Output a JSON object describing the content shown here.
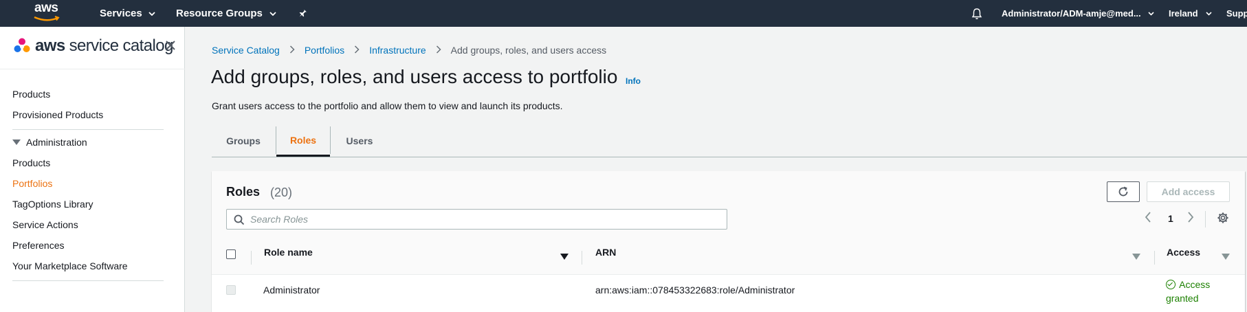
{
  "topnav": {
    "logo": "aws",
    "services_label": "Services",
    "resource_groups_label": "Resource Groups",
    "account_label": "Administrator/ADM-amje@med...",
    "region_label": "Ireland",
    "support_label": "Supp"
  },
  "sidebar": {
    "title_bold": "aws",
    "title_rest": " service catalog",
    "items": [
      {
        "label": "Products"
      },
      {
        "label": "Provisioned Products"
      }
    ],
    "admin_section_label": "Administration",
    "admin_items": [
      {
        "label": "Products"
      },
      {
        "label": "Portfolios"
      },
      {
        "label": "TagOptions Library"
      },
      {
        "label": "Service Actions"
      },
      {
        "label": "Preferences"
      },
      {
        "label": "Your Marketplace Software"
      }
    ]
  },
  "breadcrumb": {
    "items": [
      "Service Catalog",
      "Portfolios",
      "Infrastructure"
    ],
    "current": "Add groups, roles, and users access"
  },
  "page": {
    "title": "Add groups, roles, and users access to portfolio",
    "info_label": "Info",
    "description": "Grant users access to the portfolio and allow them to view and launch its products."
  },
  "tabs": [
    {
      "label": "Groups"
    },
    {
      "label": "Roles"
    },
    {
      "label": "Users"
    }
  ],
  "roles_panel": {
    "title": "Roles",
    "count": "(20)",
    "add_access_label": "Add access",
    "search_placeholder": "Search Roles",
    "current_page": "1",
    "columns": {
      "role_name": "Role name",
      "arn": "ARN",
      "access": "Access"
    },
    "rows": [
      {
        "role_name": "Administrator",
        "arn": "arn:aws:iam::078453322683:role/Administrator",
        "access": "Access granted"
      }
    ]
  },
  "colors": {
    "nav_bg": "#232f3e",
    "accent": "#ec7211",
    "link": "#0073bb",
    "success": "#1d8102"
  }
}
